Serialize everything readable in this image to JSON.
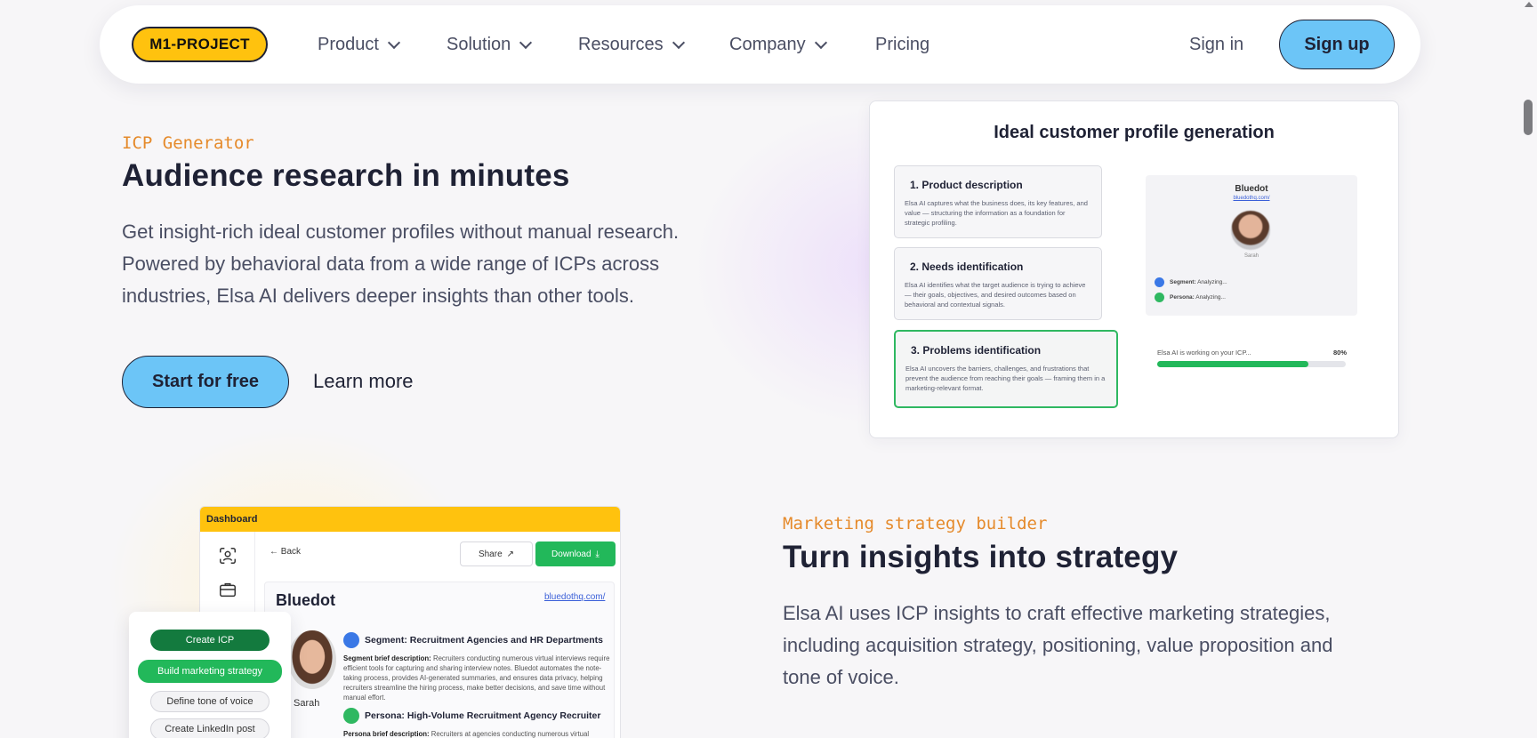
{
  "nav": {
    "logo": "M1-PROJECT",
    "items": [
      {
        "label": "Product",
        "has_dropdown": true
      },
      {
        "label": "Solution",
        "has_dropdown": true
      },
      {
        "label": "Resources",
        "has_dropdown": true
      },
      {
        "label": "Company",
        "has_dropdown": true
      },
      {
        "label": "Pricing",
        "has_dropdown": false
      }
    ],
    "sign_in": "Sign in",
    "sign_up": "Sign up"
  },
  "section_icp": {
    "eyebrow": "ICP Generator",
    "heading": "Audience research in minutes",
    "paragraph": [
      "Get insight-rich ideal customer profiles without manual research.",
      "Powered by behavioral data from a wide range of ICPs across",
      "industries, Elsa AI delivers deeper insights than other tools."
    ],
    "primary_cta": "Start for free",
    "secondary_cta": "Learn more",
    "card": {
      "title": "Ideal customer profile generation",
      "steps": [
        {
          "title": "1. Product description",
          "desc": "Elsa AI captures what the business does, its key features, and value — structuring the information as a foundation for strategic profiling."
        },
        {
          "title": "2. Needs identification",
          "desc": "Elsa AI identifies what the target audience is trying to achieve — their goals, objectives, and desired outcomes based on behavioral and contextual signals."
        },
        {
          "title": "3. Problems identification",
          "desc": "Elsa AI uncovers the barriers, challenges, and frustrations that prevent the audience from reaching their goals — framing them in a marketing-relevant format."
        }
      ],
      "profile": {
        "company": "Bluedot",
        "url": "bluedothq.com/",
        "person": "Sarah",
        "rows": [
          {
            "label": "Segment:",
            "status": "Analyzing..."
          },
          {
            "label": "Persona:",
            "status": "Analyzing..."
          }
        ]
      },
      "progress": {
        "label": "Elsa AI is working on your ICP...",
        "percent_text": "80%",
        "value": 0.8
      }
    }
  },
  "section_strategy": {
    "eyebrow": "Marketing strategy builder",
    "heading": "Turn insights into strategy",
    "paragraph": [
      "Elsa AI uses ICP insights to craft effective marketing strategies,",
      "including acquisition strategy, positioning, value proposition and",
      "tone of voice."
    ],
    "dashboard": {
      "bar_title": "Dashboard",
      "back": "Back",
      "share": "Share",
      "download": "Download",
      "company": "Bluedot",
      "url": "bluedothq.com/",
      "person": "Sarah",
      "segment_title": "Segment: Recruitment Agencies and HR Departments",
      "segment_desc_label": "Segment brief description:",
      "segment_desc": "Recruiters conducting numerous virtual interviews require efficient tools for capturing and sharing interview notes. Bluedot automates the note-taking process, provides AI-generated summaries, and ensures data privacy, helping recruiters streamline the hiring process, make better decisions, and save time without manual effort.",
      "persona_title": "Persona: High-Volume Recruitment Agency Recruiter",
      "persona_desc_label": "Persona brief description:",
      "persona_desc": "Recruiters at agencies conducting numerous virtual"
    },
    "menu": [
      "Create ICP",
      "Build marketing strategy",
      "Define tone of voice",
      "Create LinkedIn post"
    ]
  }
}
